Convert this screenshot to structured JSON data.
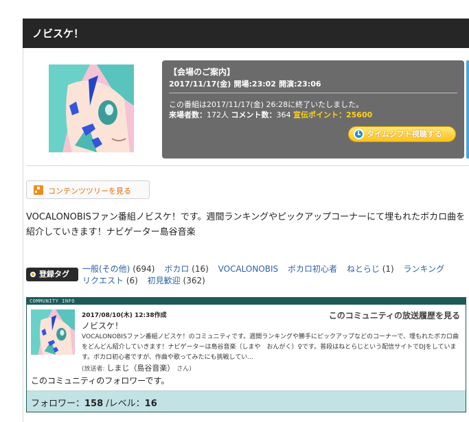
{
  "header": {
    "title": "ノビスケ！"
  },
  "program": {
    "thumbnail_icon": "anime-character-thumbnail",
    "info": {
      "heading": "【会場のご案内】",
      "date": "2017/11/17(金)",
      "open_label": "開場:",
      "open_time": "23:02",
      "start_label": "開演:",
      "start_time": "23:06",
      "ended_text": "この番組は2017/11/17(金) 26:28に終了いたしました。",
      "visitors_label": "来場者数：",
      "visitors": "172人",
      "comments_label": "コメント数：",
      "comments": "364",
      "promo_label": "宣伝ポイント：",
      "promo_points": "25600"
    },
    "timeshift_button": "タイムシフト視聴する"
  },
  "content_tree_button": "コンテンツツリーを見る",
  "description": "VOCALONOBISファン番組ノビスケ！です。週間ランキングやピックアップコーナーにて埋もれたボカロ曲を紹介していきます！ナビゲーター島谷音楽",
  "tags": {
    "badge_label": "登録タグ",
    "items": [
      {
        "name": "一般(その他)",
        "count": "(694)"
      },
      {
        "name": "ボカロ",
        "count": "(16)"
      },
      {
        "name": "VOCALONOBIS",
        "count": ""
      },
      {
        "name": "ボカロ初心者",
        "count": ""
      },
      {
        "name": "ねとらじ",
        "count": "(1)"
      },
      {
        "name": "ランキング",
        "count": ""
      },
      {
        "name": "リクエスト",
        "count": "(6)"
      },
      {
        "name": "初見歓迎",
        "count": "(362)"
      }
    ]
  },
  "community": {
    "header_label": "COMMUNITY INFO",
    "created": "2017/08/10(木) 12:38作成",
    "history_link": "このコミュニティの放送履歴を見る",
    "name": "ノビスケ！",
    "description": "VOCALONOBISファン番組ノビスケ！のコミュニティです。週間ランキングや勝手にピックアップなどのコーナーで、埋もれたボカロ曲をどんどん紹介していきます！ナビゲーターは島谷音楽（しまや　おんがく）♀です。普段はねとらじという配信サイトでDJをしています。ボカロ初心者ですが、作曲や歌ってみたにも挑戦してい...",
    "owner_prefix": "(放送者:",
    "owner_name": "しまじ（島谷音楽）",
    "owner_suffix": "さん)",
    "follow_note": "このコミュニティのフォロワーです。",
    "followers_label": "フォロワー：",
    "followers": "158",
    "level_label": " /レベル：",
    "level": "16"
  }
}
